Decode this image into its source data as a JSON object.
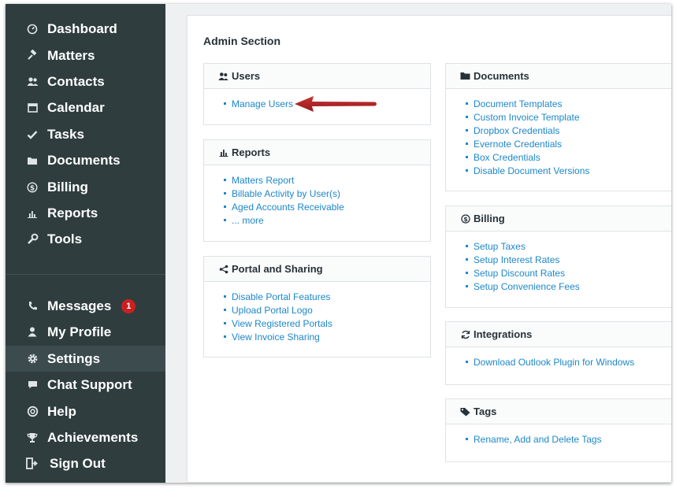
{
  "sidebar": {
    "main_items": [
      {
        "label": "Dashboard",
        "icon": "dashboard-icon"
      },
      {
        "label": "Matters",
        "icon": "gavel-icon"
      },
      {
        "label": "Contacts",
        "icon": "contacts-icon"
      },
      {
        "label": "Calendar",
        "icon": "calendar-icon"
      },
      {
        "label": "Tasks",
        "icon": "check-icon"
      },
      {
        "label": "Documents",
        "icon": "folder-icon"
      },
      {
        "label": "Billing",
        "icon": "dollar-icon"
      },
      {
        "label": "Reports",
        "icon": "bar-chart-icon"
      },
      {
        "label": "Tools",
        "icon": "wrench-icon"
      }
    ],
    "bottom_items": [
      {
        "label": "Messages",
        "icon": "phone-icon",
        "badge": "1"
      },
      {
        "label": "My Profile",
        "icon": "user-icon"
      },
      {
        "label": "Settings",
        "icon": "gear-icon",
        "active": true
      },
      {
        "label": "Chat Support",
        "icon": "chat-icon"
      },
      {
        "label": "Help",
        "icon": "lifebuoy-icon"
      },
      {
        "label": "Achievements",
        "icon": "trophy-icon"
      },
      {
        "label": "Sign Out",
        "icon": "sign-out-icon"
      }
    ]
  },
  "admin": {
    "title": "Admin Section",
    "panels": {
      "users": {
        "title": "Users",
        "links": [
          "Manage Users"
        ]
      },
      "reports": {
        "title": "Reports",
        "links": [
          "Matters Report",
          "Billable Activity by User(s)",
          "Aged Accounts Receivable",
          "... more"
        ]
      },
      "portal": {
        "title": "Portal and Sharing",
        "links": [
          "Disable Portal Features",
          "Upload Portal Logo",
          "View Registered Portals",
          "View Invoice Sharing"
        ]
      },
      "documents": {
        "title": "Documents",
        "links": [
          "Document Templates",
          "Custom Invoice Template",
          "Dropbox Credentials",
          "Evernote Credentials",
          "Box Credentials",
          "Disable Document Versions"
        ]
      },
      "billing": {
        "title": "Billing",
        "links": [
          "Setup Taxes",
          "Setup Interest Rates",
          "Setup Discount Rates",
          "Setup Convenience Fees"
        ]
      },
      "integrations": {
        "title": "Integrations",
        "links": [
          "Download Outlook Plugin for Windows"
        ]
      },
      "tags": {
        "title": "Tags",
        "links": [
          "Rename, Add and Delete Tags"
        ]
      }
    }
  },
  "colors": {
    "sidebar_bg": "#2f3d3f",
    "link": "#1d87c9",
    "badge": "#cc2020",
    "arrow": "#a31515"
  }
}
